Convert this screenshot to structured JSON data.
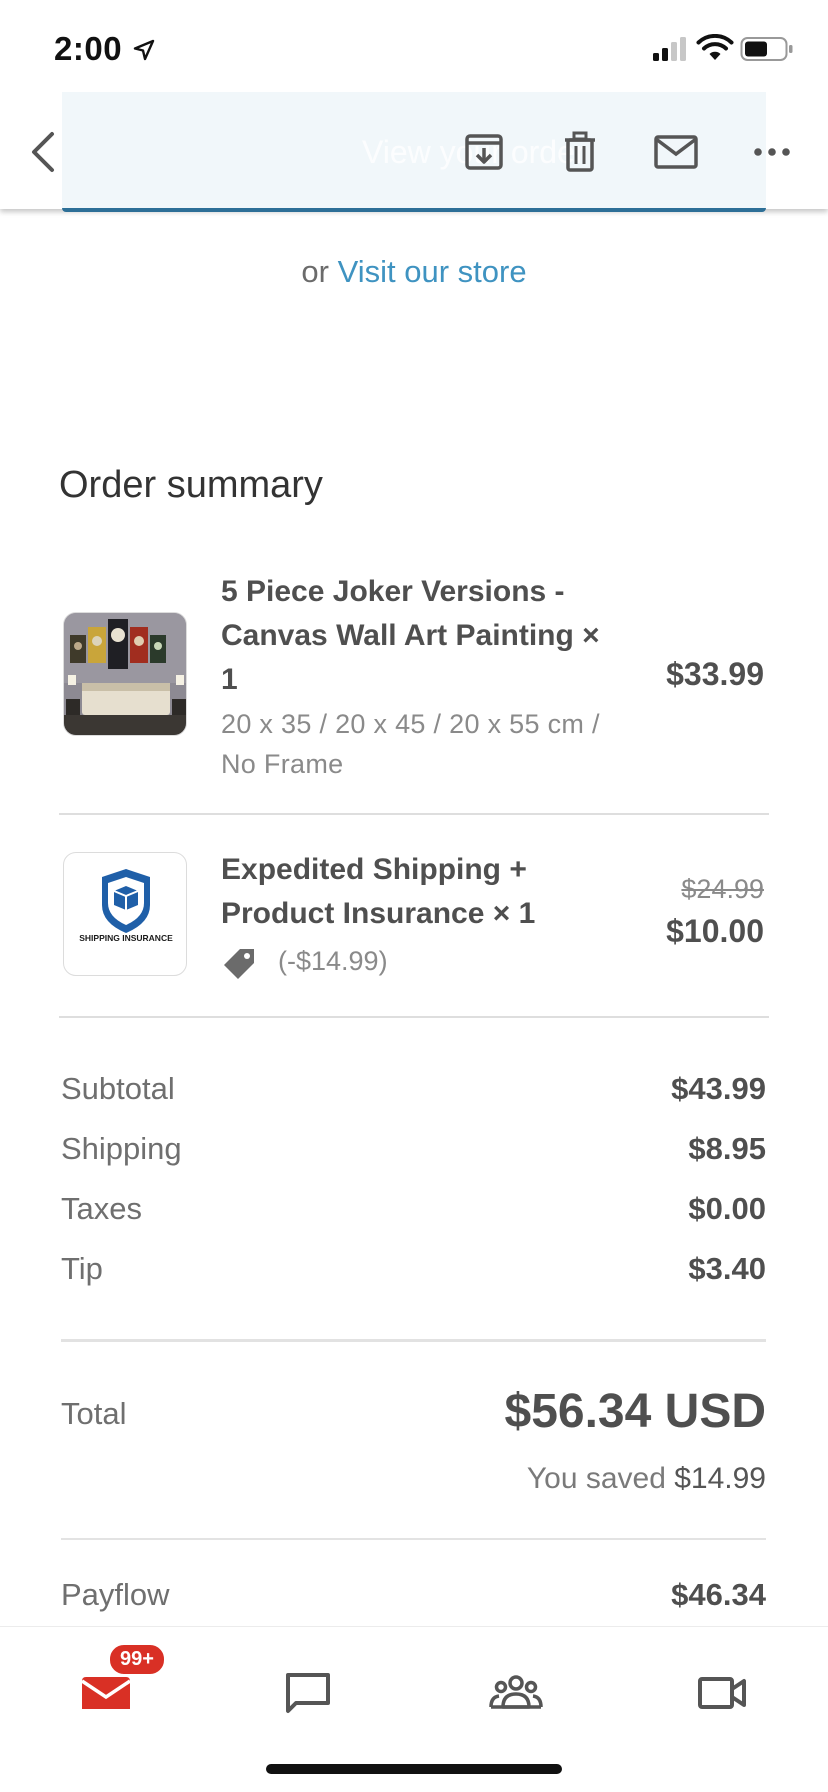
{
  "status_bar": {
    "time": "2:00",
    "icons": [
      "location-arrow-icon",
      "signal-icon",
      "wifi-icon",
      "battery-icon"
    ]
  },
  "toolbar": {
    "ghost_banner_text": "View your order",
    "icons": [
      "back-arrow-icon",
      "archive-icon",
      "trash-icon",
      "mail-icon",
      "more-icon"
    ]
  },
  "store_link": {
    "prefix": "or",
    "link_text": "Visit our store"
  },
  "order_summary": {
    "title": "Order summary",
    "items": [
      {
        "name": "5 Piece Joker Versions - Canvas Wall Art Painting × 1",
        "variant": "20 x 35 / 20 x 45 / 20 x 55 cm / No Frame",
        "price": "$33.99"
      },
      {
        "name": "Expedited Shipping + Product Insurance × 1",
        "original_price": "$24.99",
        "price": "$10.00",
        "discount": "(-$14.99)",
        "thumb_text": "SHIPPING INSURANCE"
      }
    ],
    "costs": [
      {
        "label": "Subtotal",
        "value": "$43.99"
      },
      {
        "label": "Shipping",
        "value": "$8.95"
      },
      {
        "label": "Taxes",
        "value": "$0.00"
      },
      {
        "label": "Tip",
        "value": "$3.40"
      }
    ],
    "total": {
      "label": "Total",
      "value": "$56.34 USD",
      "saved_prefix": "You saved",
      "saved_amount": "$14.99"
    },
    "payflow": {
      "label": "Payflow",
      "value": "$46.34"
    }
  },
  "bottom_nav": {
    "badge": "99+",
    "items": [
      "mail-icon",
      "chat-icon",
      "meet-icon",
      "video-icon"
    ]
  },
  "colors": {
    "link": "#3f93c1",
    "badge": "#d93025",
    "accent": "#2d6f97"
  }
}
